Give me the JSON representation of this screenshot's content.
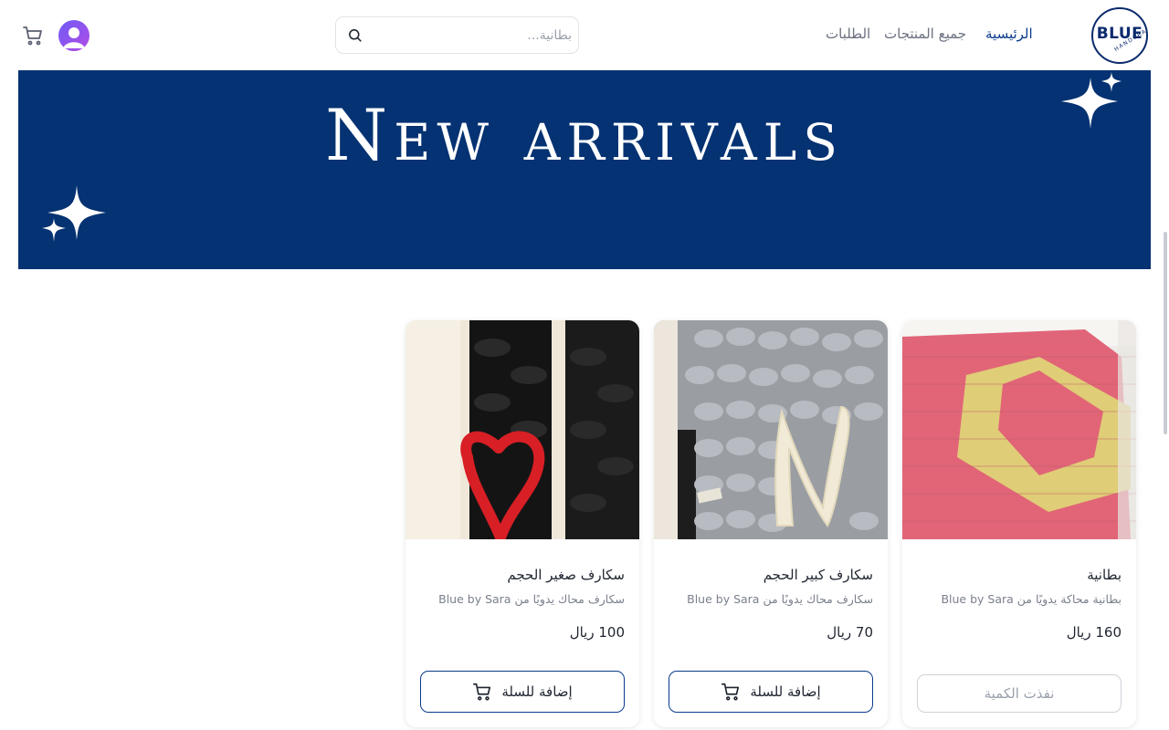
{
  "header": {
    "logo_text": "BLUE",
    "logo_subtext": "HANDCRAFTS",
    "nav": [
      {
        "label": "الرئيسية",
        "active": true
      },
      {
        "label": "جميع المنتجات",
        "active": false
      },
      {
        "label": "الطلبات",
        "active": false
      }
    ],
    "search": {
      "placeholder": "بطانية..."
    }
  },
  "banner": {
    "title": "New arrivals"
  },
  "products": [
    {
      "name": "بطانية",
      "description": "بطانية محاكة يدويًا من Blue by Sara",
      "price": "160 ريال",
      "button_label": "نفذت الكمية",
      "available": false
    },
    {
      "name": "سكارف كبير الحجم",
      "description": "سكارف محاك يدويًا من Blue by Sara",
      "price": "70 ريال",
      "button_label": "إضافة للسلة",
      "available": true
    },
    {
      "name": "سكارف صغير الحجم",
      "description": "سكارف محاك يدويًا من Blue by Sara",
      "price": "100 ريال",
      "button_label": "إضافة للسلة",
      "available": true
    }
  ],
  "colors": {
    "brand_navy": "#043272",
    "nav_active": "#0a3b8c",
    "text_muted": "#7a7f8c"
  },
  "icons": [
    "search-icon",
    "cart-icon",
    "user-avatar-icon",
    "sparkle-icon"
  ]
}
